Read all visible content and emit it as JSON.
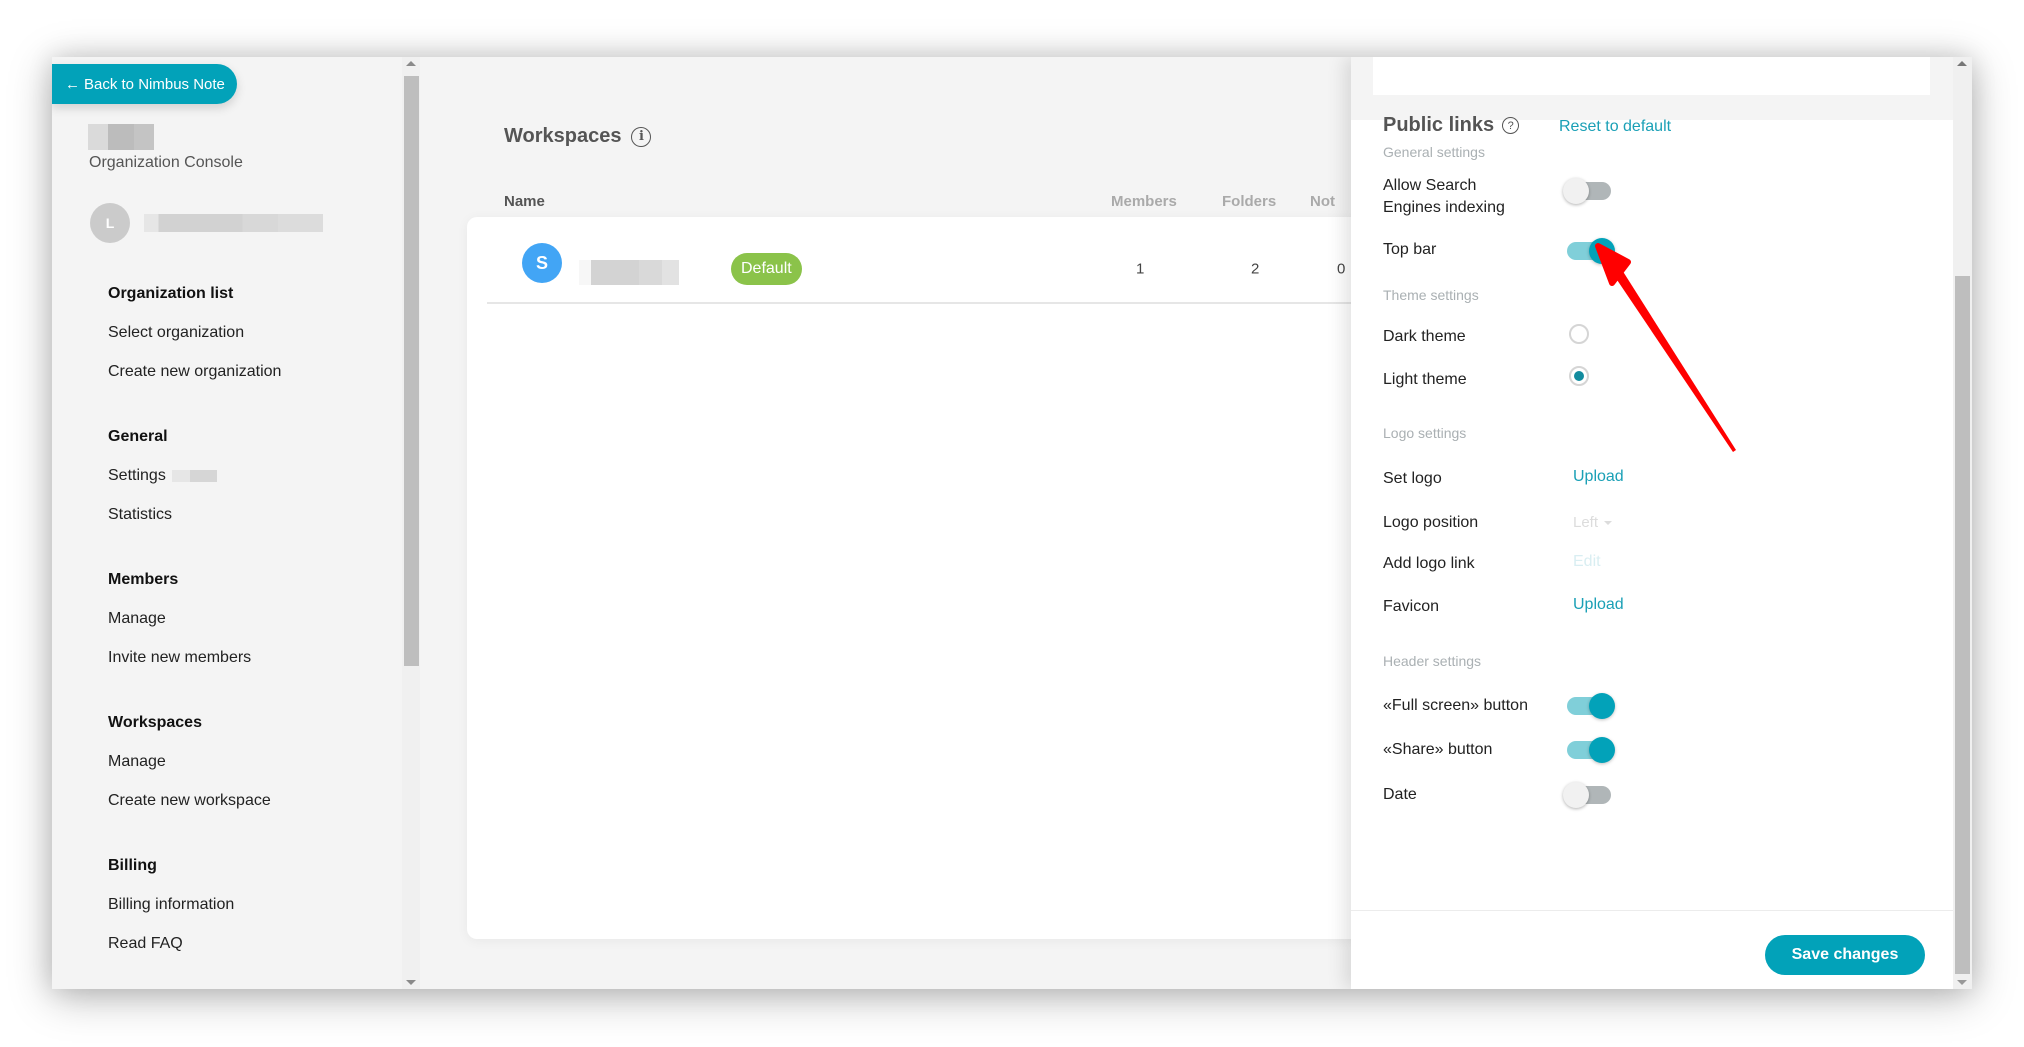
{
  "sidebar": {
    "back_button": "Back to Nimbus Note",
    "subtitle": "Organization Console",
    "user_initial": "L",
    "groups": [
      {
        "heading": "Organization list",
        "items": [
          {
            "label": "Select organization"
          },
          {
            "label": "Create new organization"
          }
        ]
      },
      {
        "heading": "General",
        "items": [
          {
            "label": "Settings"
          },
          {
            "label": "Statistics"
          }
        ]
      },
      {
        "heading": "Members",
        "items": [
          {
            "label": "Manage"
          },
          {
            "label": "Invite new members"
          }
        ]
      },
      {
        "heading": "Workspaces",
        "items": [
          {
            "label": "Manage"
          },
          {
            "label": "Create new workspace"
          }
        ]
      },
      {
        "heading": "Billing",
        "items": [
          {
            "label": "Billing information"
          },
          {
            "label": "Read FAQ"
          }
        ]
      }
    ]
  },
  "main": {
    "title": "Workspaces",
    "columns": {
      "name": "Name",
      "members": "Members",
      "folders": "Folders",
      "notes": "Not"
    },
    "rows": [
      {
        "avatar": "S",
        "badge": "Default",
        "members": "1",
        "folders": "2",
        "notes": "0"
      }
    ]
  },
  "panel": {
    "title": "Public links",
    "reset_link": "Reset to default",
    "sections": {
      "general": "General settings",
      "theme": "Theme settings",
      "logo": "Logo settings",
      "header": "Header settings"
    },
    "general": [
      {
        "label_line1": "Allow Search",
        "label_line2": "Engines indexing",
        "enabled": false
      },
      {
        "label": "Top bar",
        "enabled": true
      }
    ],
    "theme": [
      {
        "label": "Dark theme",
        "selected": false
      },
      {
        "label": "Light theme",
        "selected": true
      }
    ],
    "logo": {
      "set_logo_label": "Set logo",
      "set_logo_action": "Upload",
      "position_label": "Logo position",
      "position_value": "Left",
      "link_label": "Add logo link",
      "link_action": "Edit",
      "favicon_label": "Favicon",
      "favicon_action": "Upload"
    },
    "header": [
      {
        "label": "«Full screen» button",
        "enabled": true
      },
      {
        "label": "«Share» button",
        "enabled": true
      },
      {
        "label": "Date",
        "enabled": false
      }
    ],
    "save_button": "Save changes"
  },
  "colors": {
    "accent": "#02a2b9",
    "badge": "#8bc34a",
    "workspace_avatar": "#42a5f5",
    "annotation_arrow": "#ff0000"
  }
}
